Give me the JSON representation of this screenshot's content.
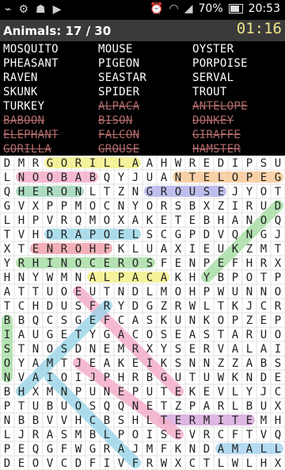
{
  "status_bar": {
    "icons": [
      "usb-icon",
      "settings-icon",
      "android-icon",
      "play-icon"
    ],
    "right_icons": [
      "alarm-icon",
      "wifi-icon",
      "signal-icon"
    ],
    "battery": "70%",
    "time": "20:53"
  },
  "header": {
    "title": "Animals: 17 / 30",
    "timer": "01:16"
  },
  "words": [
    {
      "text": "MOSQUITO",
      "found": false
    },
    {
      "text": "MOUSE",
      "found": false
    },
    {
      "text": "OYSTER",
      "found": false
    },
    {
      "text": "PHEASANT",
      "found": false
    },
    {
      "text": "PIGEON",
      "found": false
    },
    {
      "text": "PORPOISE",
      "found": false
    },
    {
      "text": "RAVEN",
      "found": false
    },
    {
      "text": "SEASTAR",
      "found": false
    },
    {
      "text": "SERVAL",
      "found": false
    },
    {
      "text": "SKUNK",
      "found": false
    },
    {
      "text": "SPIDER",
      "found": false
    },
    {
      "text": "TROUT",
      "found": false
    },
    {
      "text": "TURKEY",
      "found": false
    },
    {
      "text": "ALPACA",
      "found": true
    },
    {
      "text": "ANTELOPE",
      "found": true
    },
    {
      "text": "BABOON",
      "found": true
    },
    {
      "text": "BISON",
      "found": true
    },
    {
      "text": "DONKEY",
      "found": true
    },
    {
      "text": "ELEPHANT",
      "found": true
    },
    {
      "text": "FALCON",
      "found": true
    },
    {
      "text": "GIRAFFE",
      "found": true
    },
    {
      "text": "GORILLA",
      "found": true
    },
    {
      "text": "GROUSE",
      "found": true
    },
    {
      "text": "HAMSTER",
      "found": true
    }
  ],
  "grid": {
    "rows": [
      "DMRGORILLAAHWREDIPSU",
      "LNOOBABQYJUANTELOPEG",
      "QHERONLTZNGROUSEJYOT",
      "GVXPPMOCNYORSBXZIRUD",
      "LHPVRQMOXAKETEBHANOQ",
      "TVHDRAPOELSCGPDVQNGJ",
      "XTENROHFKLUAXIEUKZMT",
      "YRHINOCEROSFENPEFHRX",
      "HNYWMNALPACAKHYBPOTP",
      "ATTUOEUTNDLMOHPWUNNO",
      "TCHDUSFRYDGZRWLTKJCR",
      "BBQCSGEFCASKUNKOPZEP",
      "IAUGETYGACOSEASTARUO",
      "STNOSDNEMRXYSERVALAI",
      "OYAMTJEAKEIKSNNZZABS",
      "NVAIOIJPHRBGUTUWKNDE",
      "BHXMNPUNEPUTEKEVLYJC",
      "PTUBUOSQQNETZPARLBUX",
      "NBBVVHCBSHLTERMITEMH",
      "LJRASMBLPOISEVRCFTVQ",
      "PEQGFWGRAJMFKNDAMALL",
      "DEOVCDFIVFRWXCTLWLHX"
    ],
    "highlights": [
      {
        "word": "GORILLA",
        "color": "#f3f08a"
      },
      {
        "word": "NOOBAB",
        "color": "#f4aecb"
      },
      {
        "word": "ANTELOPE",
        "color": "#f7c99a"
      },
      {
        "word": "HERON",
        "color": "#9fd7b8"
      },
      {
        "word": "GROUSE",
        "color": "#b3b4ea"
      },
      {
        "word": "DRAPOEL",
        "color": "#9ed6e8"
      },
      {
        "word": "TENROH",
        "color": "#f2a3ad"
      },
      {
        "word": "RHINOCEROS",
        "color": "#a9dfa6"
      },
      {
        "word": "ALPACA",
        "color": "#f3f08a"
      },
      {
        "word": "TERMITE",
        "color": "#d9abdf"
      },
      {
        "word": "AMALL",
        "color": "#a9d5f0"
      },
      {
        "word": "diagonal-green",
        "color": "#a9dfa6"
      },
      {
        "word": "diagonal-pink",
        "color": "#f4aecb"
      },
      {
        "word": "diagonal-blue",
        "color": "#9ed6e8"
      },
      {
        "word": "diagonal-green-left",
        "color": "#a9dfa6"
      },
      {
        "word": "diagonal-pink-2",
        "color": "#f4aecb"
      },
      {
        "word": "diagonal-blue-2",
        "color": "#9ed6e8"
      }
    ]
  }
}
